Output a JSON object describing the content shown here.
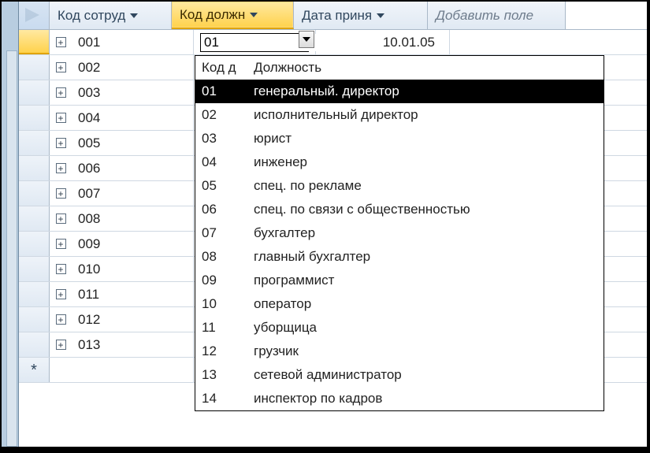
{
  "columns": {
    "employee_code": "Код сотруд",
    "position_code": "Код должн",
    "hire_date": "Дата приня",
    "add_field": "Добавить поле"
  },
  "active_row": {
    "employee_code": "001",
    "position_input": "01",
    "hire_date": "10.01.05"
  },
  "rows": [
    {
      "code": "002"
    },
    {
      "code": "003"
    },
    {
      "code": "004"
    },
    {
      "code": "005"
    },
    {
      "code": "006"
    },
    {
      "code": "007"
    },
    {
      "code": "008"
    },
    {
      "code": "009"
    },
    {
      "code": "010"
    },
    {
      "code": "011"
    },
    {
      "code": "012"
    },
    {
      "code": "013"
    }
  ],
  "new_row_marker": "*",
  "expand_symbol": "+",
  "dropdown": {
    "col1_header": "Код д",
    "col2_header": "Должность",
    "selected_index": 0,
    "items": [
      {
        "code": "01",
        "name": "генеральный. директор"
      },
      {
        "code": "02",
        "name": "исполнительный директор"
      },
      {
        "code": "03",
        "name": "юрист"
      },
      {
        "code": "04",
        "name": "инженер"
      },
      {
        "code": "05",
        "name": "спец. по рекламе"
      },
      {
        "code": "06",
        "name": "спец. по связи с общественностью"
      },
      {
        "code": "07",
        "name": "бухгалтер"
      },
      {
        "code": "08",
        "name": "главный бухгалтер"
      },
      {
        "code": "09",
        "name": "программист"
      },
      {
        "code": "10",
        "name": "оператор"
      },
      {
        "code": "11",
        "name": "уборщица"
      },
      {
        "code": "12",
        "name": "грузчик"
      },
      {
        "code": "13",
        "name": "сетевой администратор"
      },
      {
        "code": "14",
        "name": "инспектор по кадров"
      }
    ]
  }
}
